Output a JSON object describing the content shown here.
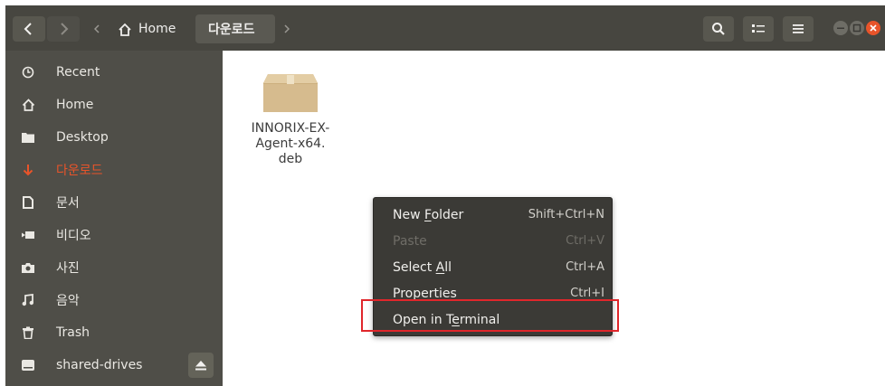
{
  "headerbar": {
    "back_icon": "chevron-left-icon",
    "forward_icon": "chevron-right-icon",
    "path": {
      "scroll_left_icon": "caret-left-icon",
      "home_label": "Home",
      "current_label": "다운로드",
      "scroll_right_icon": "caret-right-icon"
    },
    "search_icon": "search-icon",
    "view_icon": "list-view-icon",
    "menu_icon": "hamburger-menu-icon",
    "window_controls": [
      "minimize",
      "maximize",
      "close"
    ]
  },
  "sidebar": {
    "items": [
      {
        "label": "Recent",
        "icon": "clock-icon"
      },
      {
        "label": "Home",
        "icon": "home-icon"
      },
      {
        "label": "Desktop",
        "icon": "folder-icon"
      },
      {
        "label": "다운로드",
        "icon": "download-arrow-icon",
        "active": true
      },
      {
        "label": "문서",
        "icon": "document-icon"
      },
      {
        "label": "비디오",
        "icon": "video-icon"
      },
      {
        "label": "사진",
        "icon": "camera-icon"
      },
      {
        "label": "음악",
        "icon": "music-icon"
      },
      {
        "label": "Trash",
        "icon": "trash-icon"
      },
      {
        "label": "shared-drives",
        "icon": "drive-icon",
        "eject_icon": "eject-icon"
      }
    ]
  },
  "files": [
    {
      "name_lines": [
        "INNORIX-EX-",
        "Agent-x64.",
        "deb"
      ],
      "icon": "package-icon"
    }
  ],
  "context_menu": {
    "items": [
      {
        "pre": "New ",
        "mnemonic": "F",
        "post": "older",
        "accel": "Shift+Ctrl+N",
        "enabled": true
      },
      {
        "pre": "Paste",
        "mnemonic": "",
        "post": "",
        "accel": "Ctrl+V",
        "enabled": false
      },
      {
        "pre": "Select ",
        "mnemonic": "A",
        "post": "ll",
        "accel": "Ctrl+A",
        "enabled": true
      },
      {
        "pre": "",
        "mnemonic": "P",
        "post": "roperties",
        "accel": "Ctrl+I",
        "enabled": true
      },
      {
        "pre": "Open in T",
        "mnemonic": "e",
        "post": "rminal",
        "accel": "",
        "enabled": true
      }
    ]
  },
  "colors": {
    "headerbar": "#474640",
    "sidebar": "#4f4e48",
    "active_accent": "#e8542a",
    "menu_bg": "#3b3a36",
    "highlight_border": "#e0262b",
    "close_button": "#e8542a"
  }
}
